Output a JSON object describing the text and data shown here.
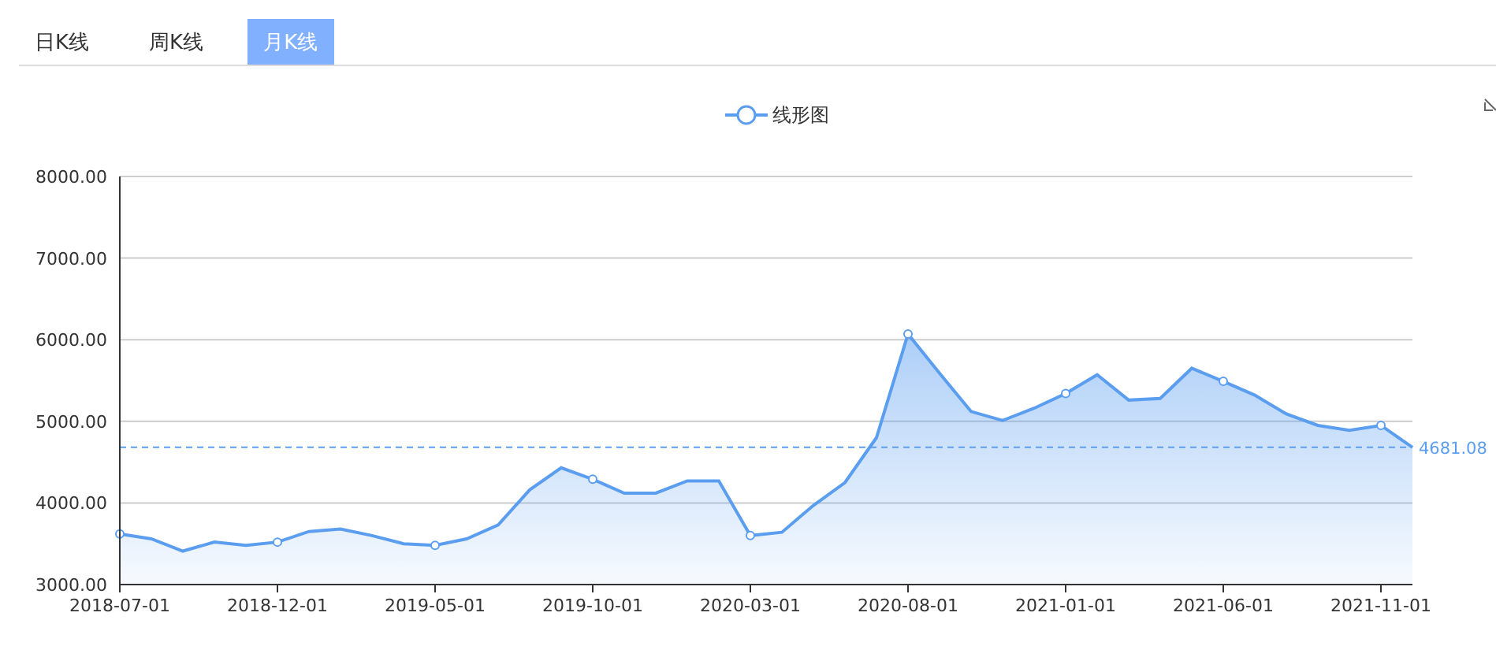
{
  "tabs": [
    {
      "label": "日K线",
      "selected": false
    },
    {
      "label": "周K线",
      "selected": false
    },
    {
      "label": "月K线",
      "selected": true
    }
  ],
  "chart": {
    "chart_data": {
      "type": "area",
      "categories": [
        "2018-07-01",
        null,
        null,
        null,
        null,
        "2018-12-01",
        null,
        null,
        null,
        null,
        "2019-05-01",
        null,
        null,
        null,
        null,
        "2019-10-01",
        null,
        null,
        null,
        null,
        "2020-03-01",
        null,
        null,
        null,
        null,
        "2020-08-01",
        null,
        null,
        null,
        null,
        "2021-01-01",
        null,
        null,
        null,
        null,
        "2021-06-01",
        null,
        null,
        null,
        null,
        "2021-11-01",
        null
      ],
      "series": [
        {
          "name": "线形图",
          "color": "#5b9ef0",
          "values": [
            3620,
            3560,
            3410,
            3520,
            3480,
            3520,
            3650,
            3680,
            3600,
            3500,
            3480,
            3560,
            3730,
            4160,
            4430,
            4290,
            4120,
            4120,
            4270,
            4270,
            3600,
            3640,
            3970,
            4250,
            4800,
            6070,
            5590,
            5120,
            5010,
            5160,
            5340,
            5570,
            5260,
            5280,
            5650,
            5490,
            5320,
            5090,
            4950,
            4890,
            4950,
            4680
          ]
        }
      ],
      "grid": true,
      "ylim": [
        3000,
        8000
      ],
      "yticks": [
        {
          "value": 3000,
          "label": "3000.00"
        },
        {
          "value": 4000,
          "label": "4000.00"
        },
        {
          "value": 5000,
          "label": "5000.00"
        },
        {
          "value": 6000,
          "label": "6000.00"
        },
        {
          "value": 7000,
          "label": "7000.00"
        },
        {
          "value": 8000,
          "label": "8000.00"
        }
      ],
      "ref_lines": [
        {
          "axis": "y",
          "value": 4681.08,
          "label": "4681.08"
        }
      ]
    }
  }
}
